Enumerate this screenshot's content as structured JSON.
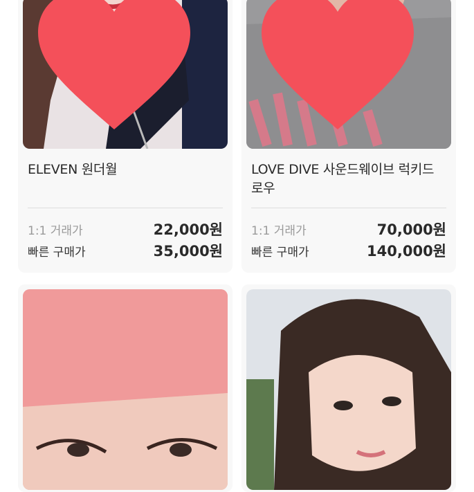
{
  "colors": {
    "heart": "#f4505a",
    "card_bg": "#f8f8f8",
    "divider": "#dedede"
  },
  "listings": [
    {
      "title": "ELEVEN 원더월",
      "price_label_1": "1:1 거래가",
      "price_1": "22,000원",
      "price_label_2": "빠른 구매가",
      "price_2": "35,000원",
      "liked": true
    },
    {
      "title": "LOVE DIVE 사운드웨이브 럭키드로우",
      "price_label_1": "1:1 거래가",
      "price_1": "70,000원",
      "price_label_2": "빠른 구매가",
      "price_2": "140,000원",
      "liked": true
    },
    {
      "title": "",
      "liked": false
    },
    {
      "title": "",
      "liked": false
    }
  ]
}
